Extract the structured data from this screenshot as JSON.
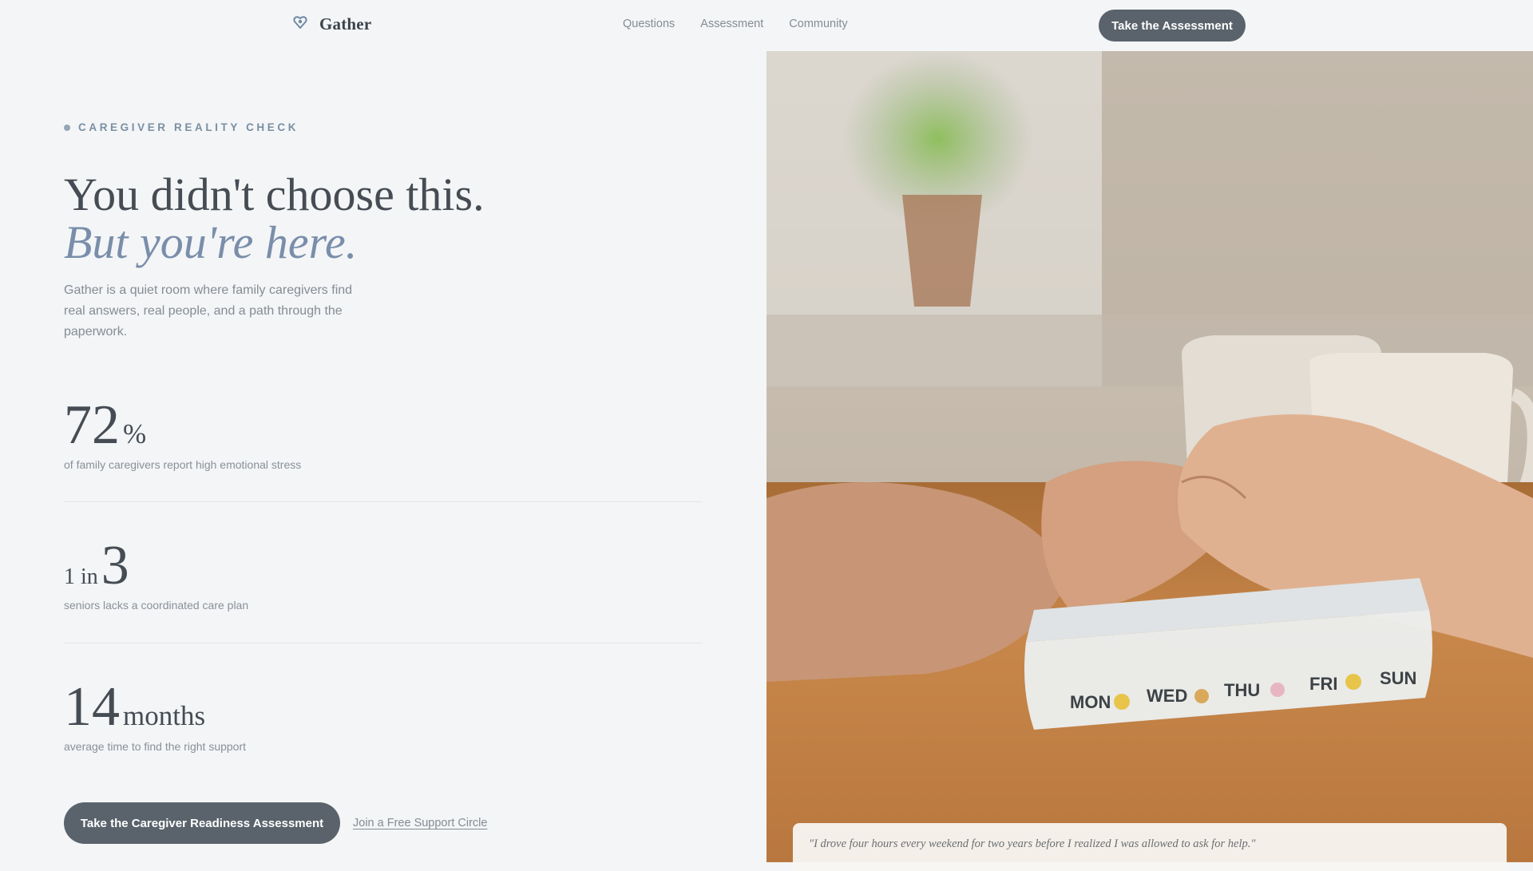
{
  "nav": {
    "brand": "Gather",
    "links": [
      "Questions",
      "Assessment",
      "Community"
    ],
    "cta": "Take the Assessment"
  },
  "hero": {
    "eyebrow": "CAREGIVER REALITY CHECK",
    "headline_line1": "You didn't choose this.",
    "headline_line2": "But you're here.",
    "lede": "Gather is a quiet room where family caregivers find real answers, real people, and a path through the paperwork."
  },
  "stats": [
    {
      "value": "72",
      "unit": "%",
      "label": "of family caregivers report high emotional stress"
    },
    {
      "prefix": "1 in",
      "value": "3",
      "label": "seniors lacks a coordinated care plan"
    },
    {
      "value": "14",
      "unit": "months",
      "label": "average time to find the right support"
    }
  ],
  "ctas": {
    "primary": "Take the Caregiver Readiness Assessment",
    "secondary": "Join a Free Support Circle"
  },
  "photo": {
    "pill_labels": [
      "MON",
      "WED",
      "THU",
      "FRI",
      "SUN"
    ]
  },
  "quote": "\"I drove four hours every weekend for two years before I realized I was allowed to ask for help.\"",
  "colors": {
    "accent": "#7a8eaa",
    "button": "#5a636b",
    "background": "#f3f5f7"
  }
}
